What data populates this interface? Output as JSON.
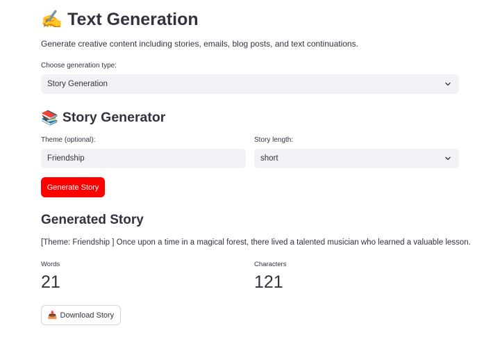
{
  "page": {
    "title": "Text Generation",
    "title_icon": "✍️",
    "description": "Generate creative content including stories, emails, blog posts, and text continuations."
  },
  "generation_type": {
    "label": "Choose generation type:",
    "selected": "Story Generation"
  },
  "story_generator": {
    "heading": "Story Generator",
    "heading_icon": "📚",
    "theme_label": "Theme (optional):",
    "theme_value": "Friendship",
    "length_label": "Story length:",
    "length_selected": "short",
    "generate_button": "Generate Story"
  },
  "result": {
    "heading": "Generated Story",
    "text": "[Theme: Friendship ] Once upon a time in a magical forest, there lived a talented musician who learned a valuable lesson.",
    "words_label": "Words",
    "words_value": "21",
    "characters_label": "Characters",
    "characters_value": "121",
    "download_button": "Download Story",
    "download_icon": "📥"
  },
  "colors": {
    "primary_button": "#ff0000",
    "input_background": "#f0f2f6",
    "text": "#31333f"
  }
}
